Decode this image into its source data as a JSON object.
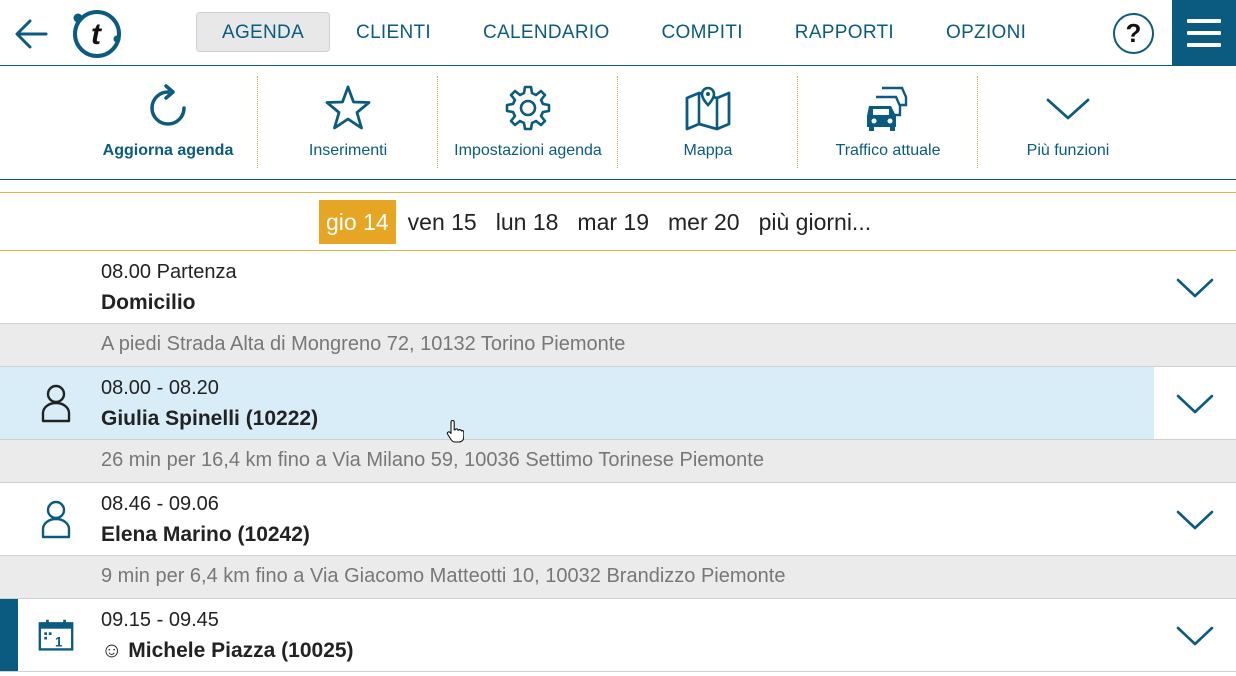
{
  "colors": {
    "brand": "#0a5b7f",
    "accent": "#e7a524",
    "selected_row": "#d9edf9"
  },
  "topbar": {
    "back_icon": "arrow-left-icon",
    "logo_letter": "t",
    "nav": [
      {
        "label": "AGENDA",
        "active": true
      },
      {
        "label": "CLIENTI"
      },
      {
        "label": "CALENDARIO"
      },
      {
        "label": "COMPITI"
      },
      {
        "label": "RAPPORTI"
      },
      {
        "label": "OPZIONI"
      }
    ],
    "help_label": "?"
  },
  "toolbar": {
    "items": [
      {
        "label": "Aggiorna agenda",
        "icon": "refresh-icon"
      },
      {
        "label": "Inserimenti",
        "icon": "star-icon"
      },
      {
        "label": "Impostazioni agenda",
        "icon": "gear-icon"
      },
      {
        "label": "Mappa",
        "icon": "map-icon"
      },
      {
        "label": "Traffico attuale",
        "icon": "traffic-icon"
      },
      {
        "label": "Più funzioni",
        "icon": "chevron-down-icon"
      }
    ]
  },
  "days": [
    {
      "label": "gio 14",
      "active": true
    },
    {
      "label": "ven 15"
    },
    {
      "label": "lun 18"
    },
    {
      "label": "mar 19"
    },
    {
      "label": "mer 20"
    },
    {
      "label": "più giorni..."
    }
  ],
  "agenda": {
    "start": {
      "time": "08.00 Partenza",
      "name": "Domicilio"
    },
    "travel1": "A piedi Strada Alta di Mongreno 72, 10132 Torino Piemonte",
    "appt1": {
      "time": "08.00 - 08.20",
      "name": "Giulia Spinelli (10222)",
      "icon": "person-icon"
    },
    "travel2": "26 min per 16,4 km fino a Via Milano 59, 10036 Settimo Torinese Piemonte",
    "appt2": {
      "time": "08.46 - 09.06",
      "name": "Elena Marino (10242)",
      "icon": "person-icon"
    },
    "travel3": "9 min per 6,4 km fino a Via Giacomo Matteotti 10, 10032 Brandizzo Piemonte",
    "appt3": {
      "time": "09.15 - 09.45",
      "name": "☺ Michele Piazza (10025)",
      "icon": "calendar-icon",
      "calendar_day": "1"
    }
  }
}
